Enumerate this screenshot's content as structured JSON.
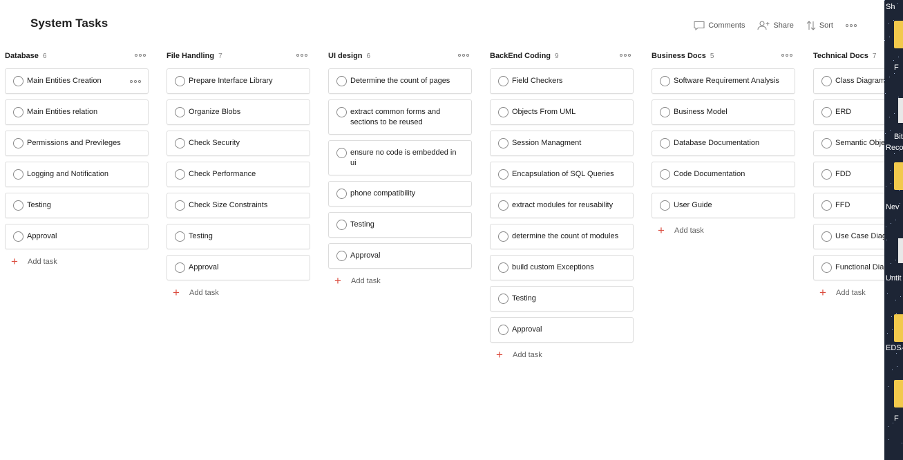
{
  "page": {
    "title": "System Tasks"
  },
  "toolbar": {
    "comments": "Comments",
    "share": "Share",
    "sort": "Sort"
  },
  "columns": [
    {
      "title": "Database",
      "count": "6",
      "add": "Add task",
      "tasks": [
        "Main Entities Creation",
        "Main Entities relation",
        "Permissions and Previleges",
        "Logging and Notification",
        "Testing",
        "Approval"
      ]
    },
    {
      "title": "File Handling",
      "count": "7",
      "add": "Add task",
      "tasks": [
        "Prepare Interface Library",
        "Organize Blobs",
        "Check Security",
        "Check Performance",
        "Check Size Constraints",
        "Testing",
        "Approval"
      ]
    },
    {
      "title": "UI design",
      "count": "6",
      "add": "Add task",
      "tasks": [
        "Determine the count of pages",
        "extract common forms and sections to be reused",
        "ensure no code is embedded in ui",
        "phone compatibility",
        "Testing",
        "Approval"
      ]
    },
    {
      "title": "BackEnd Coding",
      "count": "9",
      "add": "Add task",
      "tasks": [
        "Field Checkers",
        "Objects From UML",
        "Session Managment",
        "Encapsulation of SQL Queries",
        "extract modules for reusability",
        "determine the count of modules",
        "build custom Exceptions",
        "Testing",
        "Approval"
      ]
    },
    {
      "title": "Business Docs",
      "count": "5",
      "add": "Add task",
      "tasks": [
        "Software Requirement Analysis",
        "Business Model",
        "Database Documentation",
        "Code Documentation",
        "User Guide"
      ]
    },
    {
      "title": "Technical Docs",
      "count": "7",
      "add": "Add task",
      "tasks": [
        "Class Diagram",
        "ERD",
        "Semantic Obje",
        "FDD",
        "FFD",
        "Use Case Diagr",
        "Functional Diag"
      ]
    }
  ],
  "desktop": {
    "labels": [
      "Sh",
      "F",
      "Bit",
      "Reco",
      "Nev",
      "Untit",
      "EDS-",
      "F"
    ]
  },
  "colors": {
    "accent_add": "#db4c3f",
    "desktop_bg": "#1d2535"
  }
}
